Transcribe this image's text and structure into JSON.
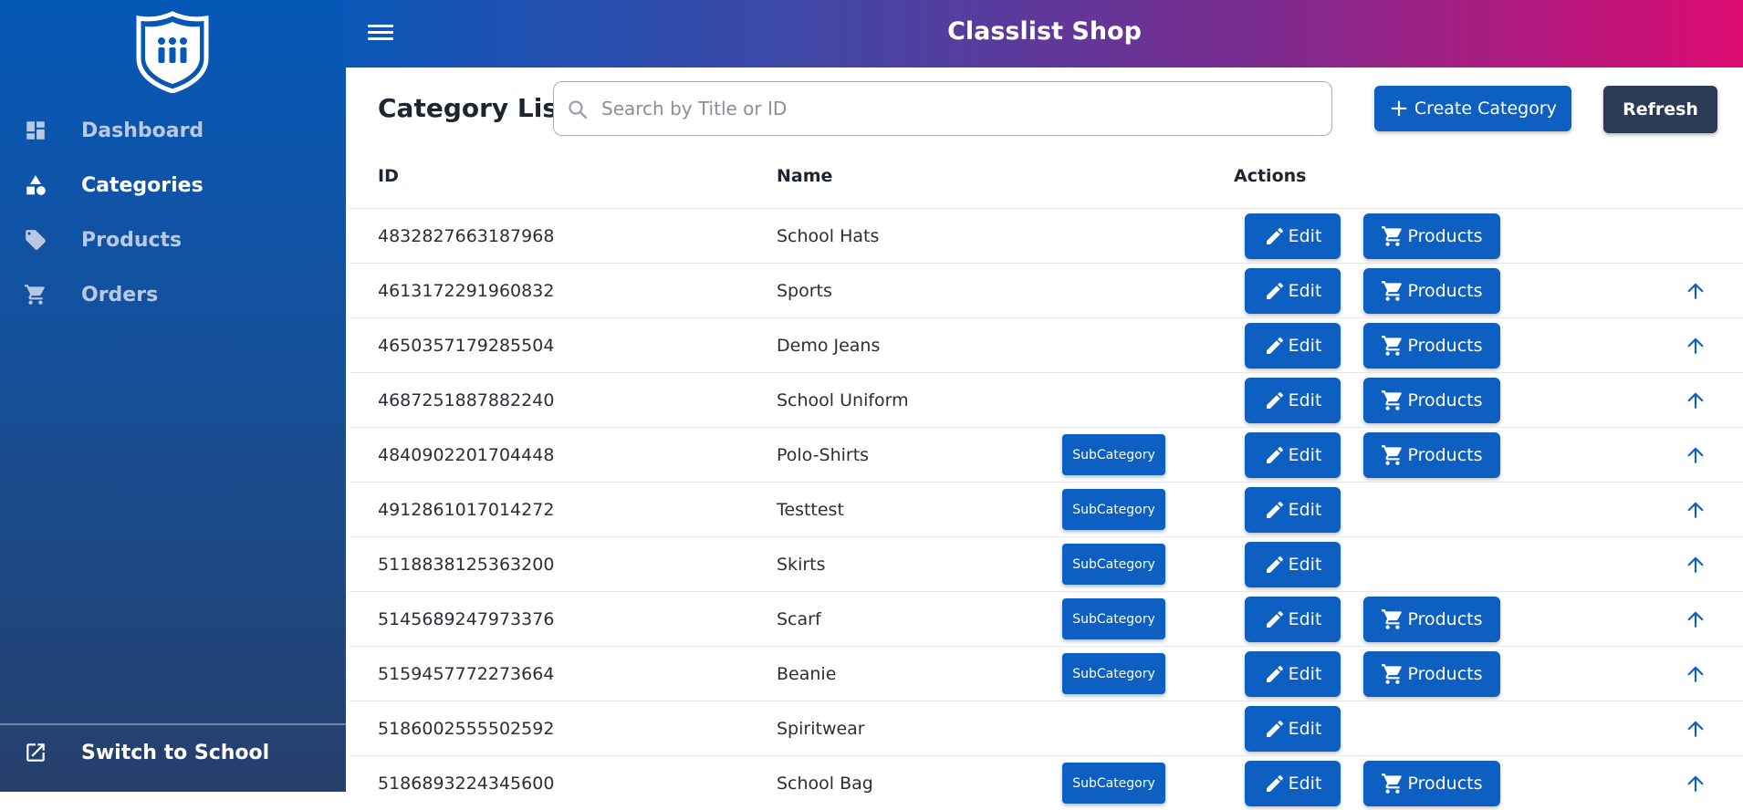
{
  "colors": {
    "primary": "#0e5fc2",
    "refresh": "#2b3a55",
    "header_gradient": [
      "#0a57b7",
      "#7a2c8f",
      "#dc0b72"
    ],
    "sidebar_gradient": [
      "#0658b8",
      "#263f6b"
    ]
  },
  "header": {
    "title": "Classlist Shop",
    "menu_icon": "hamburger-menu-icon"
  },
  "sidebar": {
    "logo": "school-shield-logo",
    "items": [
      {
        "label": "Dashboard",
        "icon": "dashboard-icon",
        "active": false
      },
      {
        "label": "Categories",
        "icon": "categories-icon",
        "active": true
      },
      {
        "label": "Products",
        "icon": "tag-icon",
        "active": false
      },
      {
        "label": "Orders",
        "icon": "cart-icon",
        "active": false
      }
    ],
    "footer": {
      "label": "Switch to School",
      "icon": "open-external-icon"
    }
  },
  "main": {
    "title": "Category List",
    "search": {
      "placeholder": "Search by Title or ID",
      "value": ""
    },
    "create_button": "Create Category",
    "refresh_button": "Refresh",
    "columns": {
      "id": "ID",
      "name": "Name",
      "actions": "Actions"
    },
    "labels": {
      "subcategory": "SubCategory",
      "edit": "Edit",
      "products": "Products"
    },
    "rows": [
      {
        "id": "4832827663187968",
        "name": "School Hats",
        "subcategory": false,
        "products": true,
        "up": false
      },
      {
        "id": "4613172291960832",
        "name": "Sports",
        "subcategory": false,
        "products": true,
        "up": true
      },
      {
        "id": "4650357179285504",
        "name": "Demo Jeans",
        "subcategory": false,
        "products": true,
        "up": true
      },
      {
        "id": "4687251887882240",
        "name": "School Uniform",
        "subcategory": false,
        "products": true,
        "up": true
      },
      {
        "id": "4840902201704448",
        "name": "Polo-Shirts",
        "subcategory": true,
        "products": true,
        "up": true
      },
      {
        "id": "4912861017014272",
        "name": "Testtest",
        "subcategory": true,
        "products": false,
        "up": true
      },
      {
        "id": "5118838125363200",
        "name": "Skirts",
        "subcategory": true,
        "products": false,
        "up": true
      },
      {
        "id": "5145689247973376",
        "name": "Scarf",
        "subcategory": true,
        "products": true,
        "up": true
      },
      {
        "id": "5159457772273664",
        "name": "Beanie",
        "subcategory": true,
        "products": true,
        "up": true
      },
      {
        "id": "5186002555502592",
        "name": "Spiritwear",
        "subcategory": false,
        "products": false,
        "up": true
      },
      {
        "id": "5186893224345600",
        "name": "School Bag",
        "subcategory": true,
        "products": true,
        "up": true
      }
    ]
  }
}
